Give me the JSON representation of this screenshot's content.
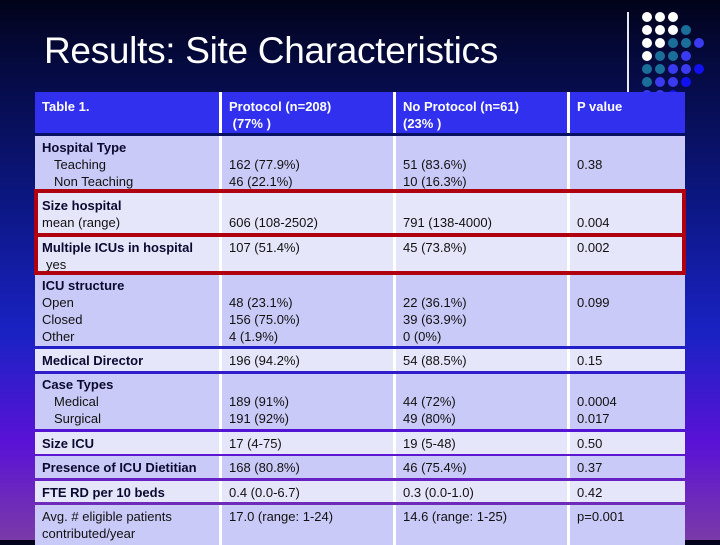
{
  "slide": {
    "title": "Results: Site Characteristics"
  },
  "decor": {
    "dot_colors": [
      "#ffffff",
      "#1a6f9a",
      "#3a3af0",
      "#1010f0"
    ]
  },
  "table": {
    "headers": {
      "label": "Table 1.",
      "protocol_line1": "Protocol (n=208)",
      "protocol_line2": " (77% )",
      "no_protocol_line1": "No Protocol (n=61)",
      "no_protocol_line2": "(23% )",
      "pvalue": "P value"
    },
    "rows": {
      "hospital_type": {
        "label": "Hospital Type",
        "sub1": "Teaching",
        "sub2": "Non Teaching",
        "protocol1": "162 (77.9%)",
        "protocol2": "46 (22.1%)",
        "noprotocol1": "51 (83.6%)",
        "noprotocol2": "10 (16.3%)",
        "p": "0.38"
      },
      "size_hospital": {
        "label": "Size hospital",
        "sub": "mean (range)",
        "protocol": "606 (108-2502)",
        "noprotocol": "791 (138-4000)",
        "p": "0.004"
      },
      "multiple_icus": {
        "label": "Multiple ICUs in hospital",
        "sub": "yes",
        "protocol": "107 (51.4%)",
        "noprotocol": "45 (73.8%)",
        "p": "0.002"
      },
      "icu_structure": {
        "label": "ICU structure",
        "sub1": "Open",
        "sub2": "Closed",
        "sub3": "Other",
        "protocol1": "48 (23.1%)",
        "protocol2": "156 (75.0%)",
        "protocol3": "4 (1.9%)",
        "noprotocol1": "22 (36.1%)",
        "noprotocol2": "39 (63.9%)",
        "noprotocol3": "0 (0%)",
        "p": "0.099"
      },
      "medical_director": {
        "label": "Medical Director",
        "protocol": "196 (94.2%)",
        "noprotocol": "54 (88.5%)",
        "p": "0.15"
      },
      "case_types": {
        "label": "Case Types",
        "sub1": "Medical",
        "sub2": "Surgical",
        "protocol1": "189 (91%)",
        "protocol2": "191 (92%)",
        "noprotocol1": "44 (72%)",
        "noprotocol2": "49 (80%)",
        "p1": "0.0004",
        "p2": "0.017"
      },
      "size_icu": {
        "label": "Size ICU",
        "protocol": "17 (4-75)",
        "noprotocol": "19 (5-48)",
        "p": "0.50"
      },
      "dietitian": {
        "label": "Presence of ICU Dietitian",
        "protocol": "168 (80.8%)",
        "noprotocol": "46 (75.4%)",
        "p": "0.37"
      },
      "fte_rd": {
        "label": "FTE RD per 10 beds",
        "protocol": "0.4 (0.0-6.7)",
        "noprotocol": "0.3 (0.0-1.0)",
        "p": "0.42"
      },
      "avg_patients": {
        "label1": "Avg. # eligible patients",
        "label2": "contributed/year",
        "protocol": "17.0 (range: 1-24)",
        "noprotocol": "14.6 (range: 1-25)",
        "p": "p=0.001"
      }
    }
  }
}
